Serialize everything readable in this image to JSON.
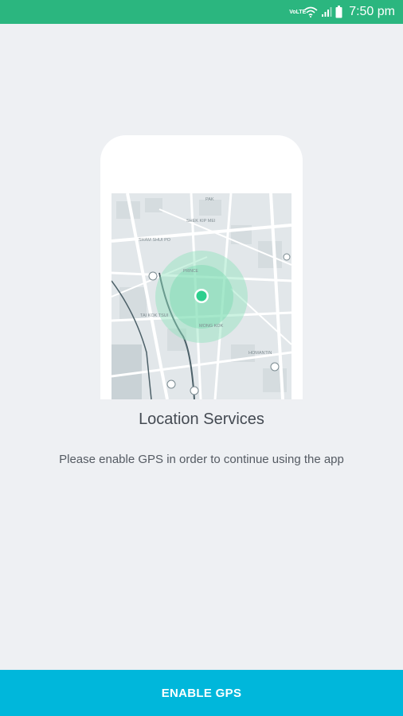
{
  "status_bar": {
    "volte_label": "VoLTE",
    "time": "7:50 pm",
    "icons": [
      "volte-icon",
      "wifi-icon",
      "signal-icon",
      "battery-icon"
    ]
  },
  "illustration": {
    "map_labels": [
      "PAK",
      "SHEK KIP MEI",
      "SHAM SHUI PO",
      "PRINCE",
      "TAI KOK TSUI",
      "MONG KOK",
      "HOMANTIN"
    ],
    "icons": [
      "phone-frame-icon",
      "map-icon",
      "location-pin-icon"
    ]
  },
  "main": {
    "title": "Location Services",
    "message": "Please enable GPS in order to continue using the app"
  },
  "footer": {
    "button_label": "ENABLE GPS"
  },
  "colors": {
    "status_bar": "#2bb67f",
    "accent": "#2ecf8e",
    "button": "#00b7db",
    "background": "#eef0f3"
  }
}
